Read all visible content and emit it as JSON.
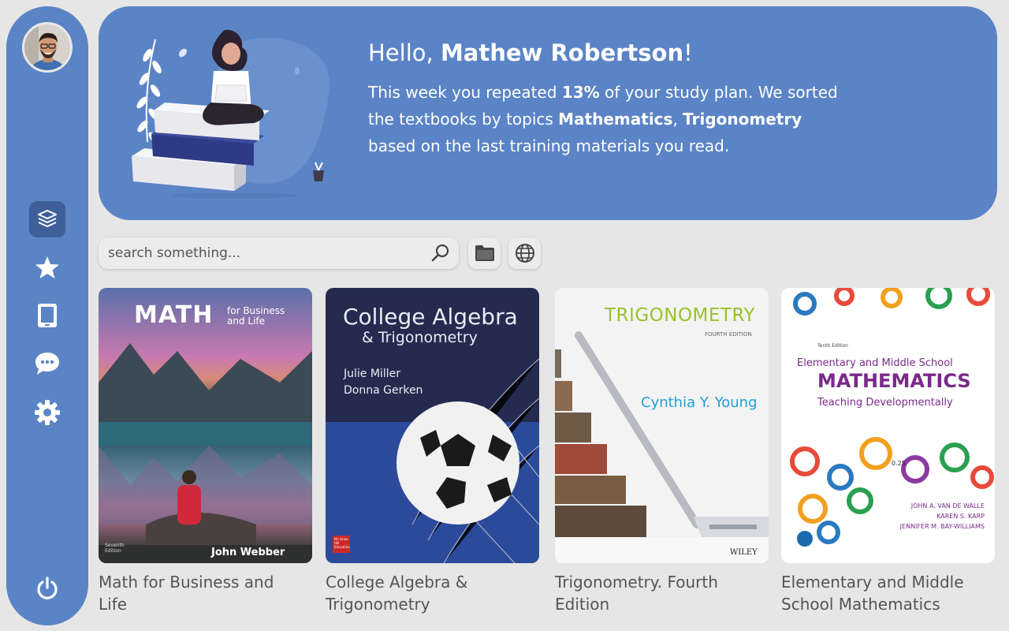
{
  "user": {
    "greeting": "Hello, ",
    "name": "Mathew Robertson",
    "exclaim": "!"
  },
  "banner": {
    "p1": "This week you repeated ",
    "percent": "13%",
    "p2": " of your study plan. We sorted the textbooks by topics ",
    "topic1": "Mathematics",
    "p3": ", ",
    "topic2": "Trigonometry",
    "p4": " based on the last training materials you read."
  },
  "search": {
    "placeholder": "search something..."
  },
  "sidebar": {
    "items": [
      "library-icon",
      "star-icon",
      "tablet-icon",
      "chat-icon",
      "settings-icon"
    ],
    "logout": "power-icon"
  },
  "books": [
    {
      "title": "Math for Business and Life",
      "cover_title": "MATH",
      "cover_sub1": "for Business",
      "cover_sub2": "and Life",
      "author": "John Webber",
      "edition": "Seventh Edition"
    },
    {
      "title": "College Algebra & Trigonometry",
      "cover_title": "College Algebra",
      "cover_sub": "& Trigonometry",
      "author1": "Julie Miller",
      "author2": "Donna Gerken",
      "publisher": "Mc Graw Hill Education"
    },
    {
      "title": "Trigonometry. Fourth Edition",
      "cover_title": "TRIGONOMETRY",
      "edition": "FOURTH EDITION",
      "author": "Cynthia Y. Young",
      "publisher": "WILEY"
    },
    {
      "title": "Elementary and Middle School Mathematics",
      "edition": "Tenth Edition",
      "cover_line1": "Elementary and Middle School",
      "cover_line2": "MATHEMATICS",
      "cover_line3": "Teaching Developmentally",
      "author1": "JOHN A. VAN DE WALLE",
      "author2": "KAREN S. KARP",
      "author3": "JENNIFER M. BAY-WILLIAMS",
      "number": "0.25"
    }
  ],
  "colors": {
    "accent": "#5b84c6",
    "active": "#3e5f99",
    "background": "#e6e6e6"
  }
}
